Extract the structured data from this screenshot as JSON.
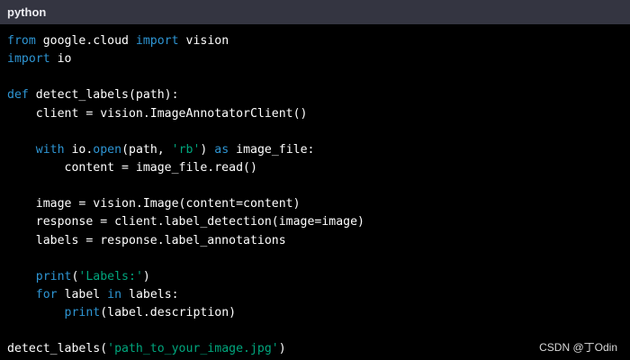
{
  "header": {
    "language": "python"
  },
  "code_lines": [
    [
      {
        "t": "from",
        "k": "kw"
      },
      {
        "t": " google.cloud ",
        "k": "plain"
      },
      {
        "t": "import",
        "k": "kw"
      },
      {
        "t": " vision",
        "k": "plain"
      }
    ],
    [
      {
        "t": "import",
        "k": "kw"
      },
      {
        "t": " io",
        "k": "plain"
      }
    ],
    [],
    [
      {
        "t": "def",
        "k": "kw"
      },
      {
        "t": " detect_labels",
        "k": "plain"
      },
      {
        "t": "(path):",
        "k": "plain"
      }
    ],
    [
      {
        "t": "    client = vision.ImageAnnotatorClient()",
        "k": "plain"
      }
    ],
    [],
    [
      {
        "t": "    ",
        "k": "plain"
      },
      {
        "t": "with",
        "k": "kw"
      },
      {
        "t": " io.",
        "k": "plain"
      },
      {
        "t": "open",
        "k": "kw"
      },
      {
        "t": "(path, ",
        "k": "plain"
      },
      {
        "t": "'rb'",
        "k": "str"
      },
      {
        "t": ") ",
        "k": "plain"
      },
      {
        "t": "as",
        "k": "kw"
      },
      {
        "t": " image_file:",
        "k": "plain"
      }
    ],
    [
      {
        "t": "        content = image_file.read()",
        "k": "plain"
      }
    ],
    [],
    [
      {
        "t": "    image = vision.Image(content=content)",
        "k": "plain"
      }
    ],
    [
      {
        "t": "    response = client.label_detection(image=image)",
        "k": "plain"
      }
    ],
    [
      {
        "t": "    labels = response.label_annotations",
        "k": "plain"
      }
    ],
    [],
    [
      {
        "t": "    ",
        "k": "plain"
      },
      {
        "t": "print",
        "k": "kw"
      },
      {
        "t": "(",
        "k": "plain"
      },
      {
        "t": "'Labels:'",
        "k": "str"
      },
      {
        "t": ")",
        "k": "plain"
      }
    ],
    [
      {
        "t": "    ",
        "k": "plain"
      },
      {
        "t": "for",
        "k": "kw"
      },
      {
        "t": " label ",
        "k": "plain"
      },
      {
        "t": "in",
        "k": "kw"
      },
      {
        "t": " labels:",
        "k": "plain"
      }
    ],
    [
      {
        "t": "        ",
        "k": "plain"
      },
      {
        "t": "print",
        "k": "kw"
      },
      {
        "t": "(label.description)",
        "k": "plain"
      }
    ],
    [],
    [
      {
        "t": "detect_labels(",
        "k": "plain"
      },
      {
        "t": "'path_to_your_image.jpg'",
        "k": "str"
      },
      {
        "t": ")",
        "k": "plain"
      }
    ]
  ],
  "watermark": "CSDN @丁Odin",
  "colors": {
    "keyword": "#2e95d3",
    "string": "#00a67d",
    "text": "#ffffff",
    "background": "#000000",
    "header_bg": "#343541"
  }
}
